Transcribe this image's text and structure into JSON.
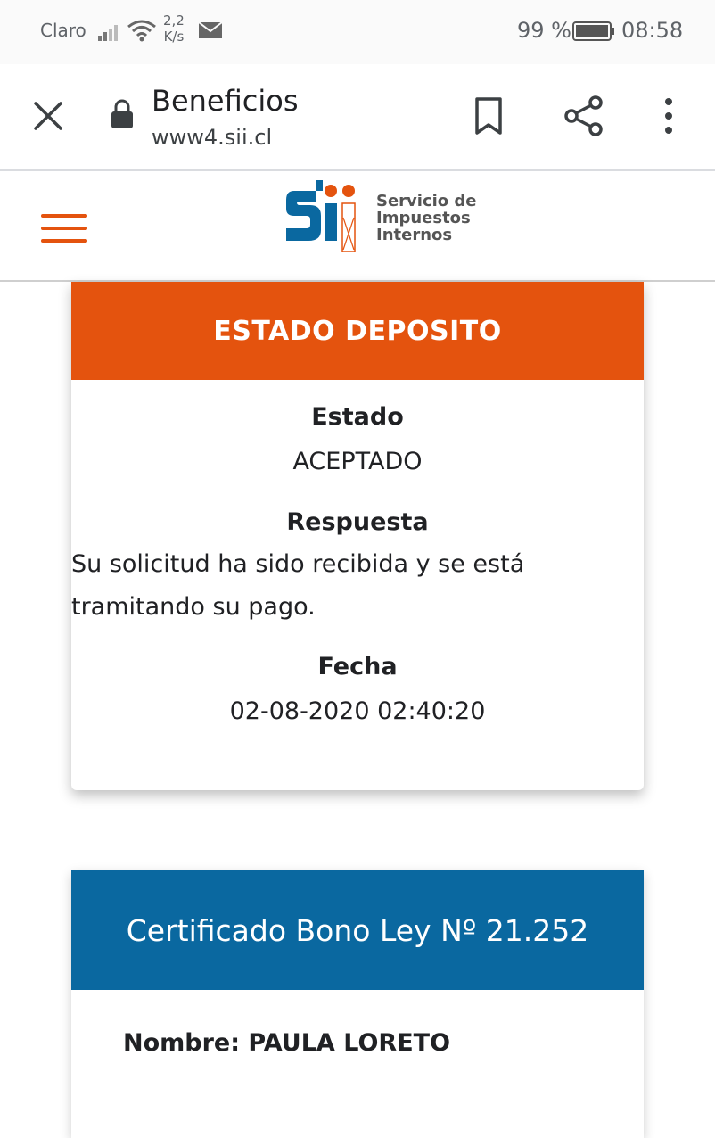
{
  "status_bar": {
    "carrier": "Claro",
    "speed_top": "2,2",
    "speed_bottom": "K/s",
    "battery_percent": "99 %",
    "time": "08:58"
  },
  "tab_bar": {
    "title": "Beneficios",
    "url": "www4.sii.cl"
  },
  "site_header": {
    "logo_line1": "Servicio de",
    "logo_line2": "Impuestos",
    "logo_line3": "Internos"
  },
  "deposit_card": {
    "title": "ESTADO DEPOSITO",
    "estado_label": "Estado",
    "estado_value": "ACEPTADO",
    "respuesta_label": "Respuesta",
    "respuesta_value": "Su solicitud ha sido recibida y se está tramitando su pago.",
    "fecha_label": "Fecha",
    "fecha_value": "02-08-2020 02:40:20"
  },
  "certificate_card": {
    "title": "Certificado Bono Ley Nº 21.252",
    "name_label": "Nombre: PAULA LORETO"
  },
  "colors": {
    "orange": "#e4530e",
    "blue": "#0a68a0"
  }
}
